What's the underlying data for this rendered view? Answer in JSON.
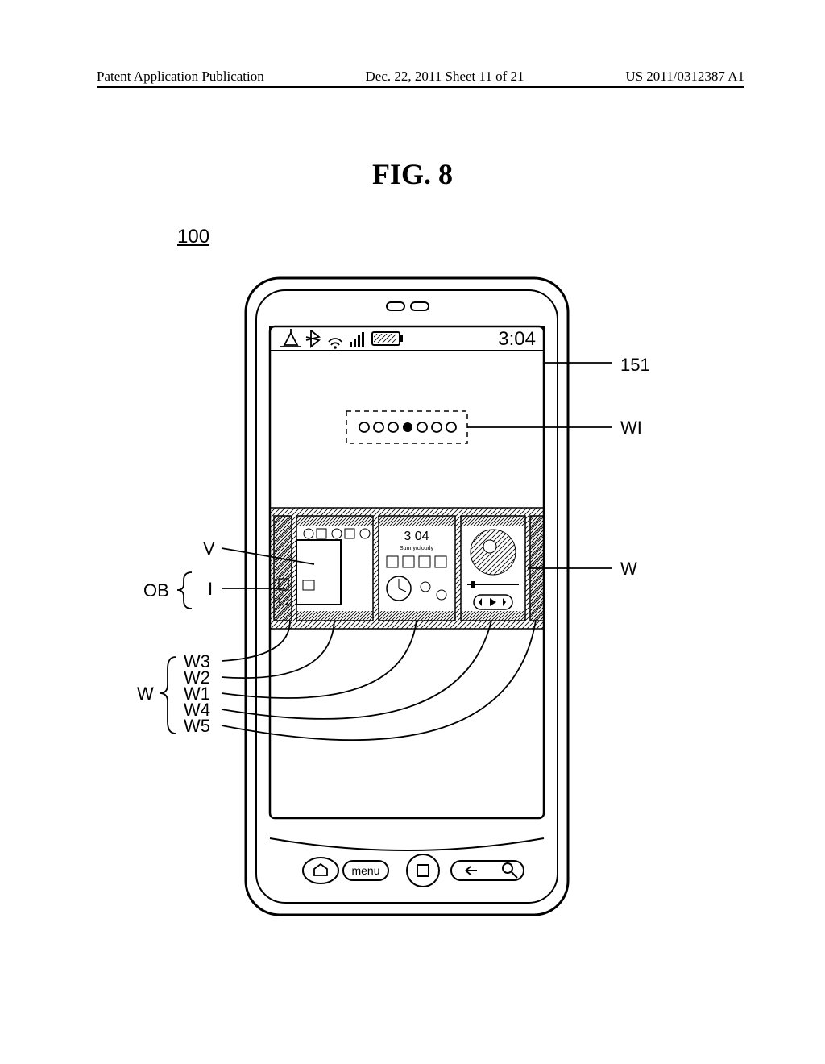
{
  "header": {
    "left": "Patent Application Publication",
    "center": "Dec. 22, 2011  Sheet 11 of 21",
    "right": "US 2011/0312387 A1"
  },
  "figure_title": "FIG. 8",
  "ref_100": "100",
  "status_time": "3:04",
  "thumb_time": "3  04",
  "thumb_weather": "Sunny/cloudy",
  "menu_btn": "menu",
  "labels": {
    "l151": "151",
    "lWI": "WI",
    "lW_right": "W",
    "lV": "V",
    "lOB": "OB",
    "lI": "I",
    "lW_left": "W",
    "lW1": "W1",
    "lW2": "W2",
    "lW3": "W3",
    "lW4": "W4",
    "lW5": "W5"
  }
}
